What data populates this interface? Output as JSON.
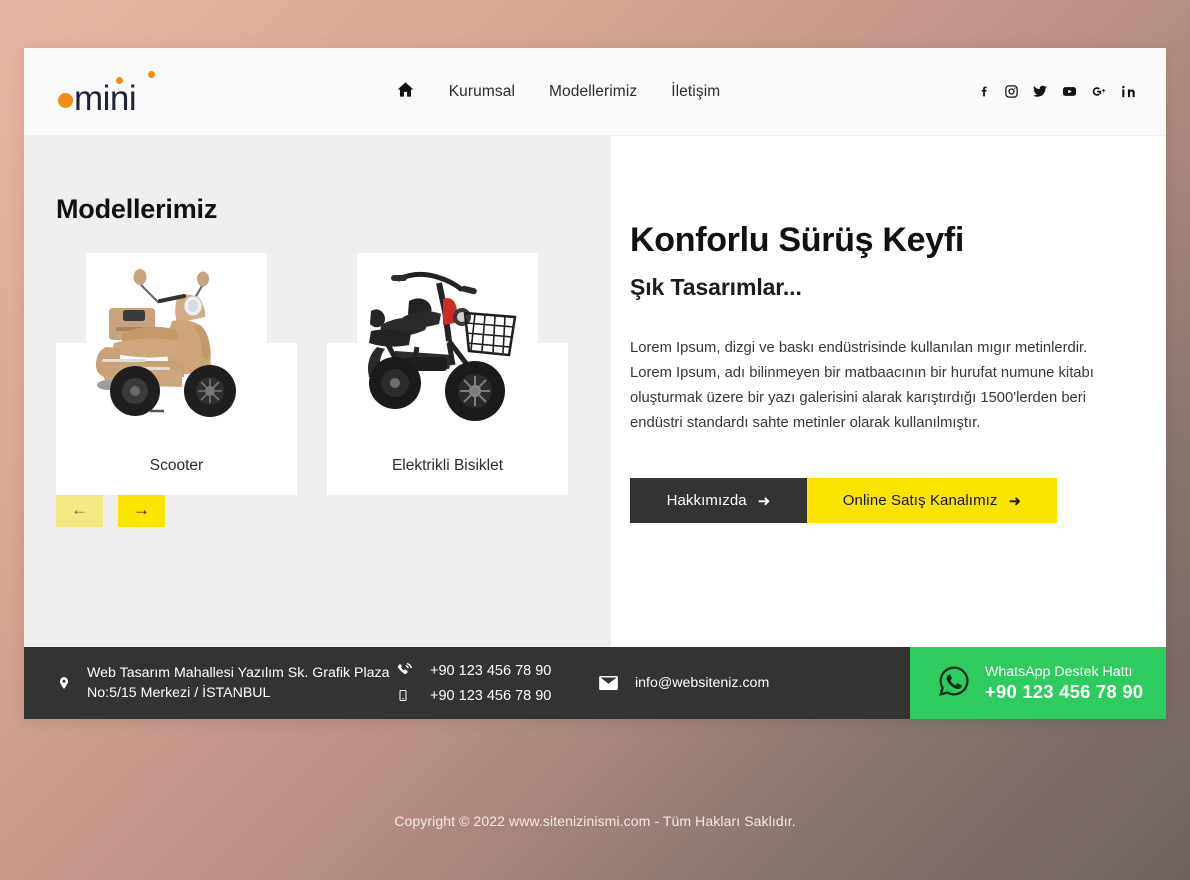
{
  "site": {
    "logo": {
      "text": "mini",
      "dot_color": "#f28d15",
      "word_color": "#1e2337"
    }
  },
  "nav": {
    "home_icon": "home-icon",
    "items": [
      {
        "label": "Kurumsal"
      },
      {
        "label": "Modellerimiz"
      },
      {
        "label": "İletişim"
      }
    ]
  },
  "socials": [
    {
      "name": "facebook-icon"
    },
    {
      "name": "instagram-icon"
    },
    {
      "name": "twitter-icon"
    },
    {
      "name": "youtube-icon"
    },
    {
      "name": "google-plus-icon"
    },
    {
      "name": "linkedin-icon"
    }
  ],
  "left": {
    "section_title": "Modellerimiz",
    "cards": [
      {
        "title": "Scooter",
        "image": "scooter-photo"
      },
      {
        "title": "Elektrikli Bisiklet",
        "image": "electric-bike-photo"
      }
    ],
    "carousel": {
      "prev_label": "←",
      "next_label": "→",
      "prev_color": "#f2ea7e",
      "next_color": "#fbe400"
    }
  },
  "right": {
    "title": "Konforlu Sürüş Keyfi",
    "subtitle": "Şık Tasarımlar...",
    "paragraph": "Lorem Ipsum, dizgi ve baskı endüstrisinde kullanılan mıgır metinlerdir. Lorem Ipsum, adı bilinmeyen bir matbaacının bir hurufat numune kitabı oluşturmak üzere bir yazı galerisini alarak karıştırdığı 1500'lerden beri endüstri standardı sahte metinler olarak kullanılmıştır.",
    "buttons": [
      {
        "label": "Hakkımızda",
        "arrow": "➜",
        "bg": "#333333",
        "fg": "#ffffff"
      },
      {
        "label": "Online Satış Kanalımız",
        "arrow": "➜",
        "bg": "#fbe400",
        "fg": "#141414"
      }
    ]
  },
  "contactbar": {
    "address": "Web Tasarım Mahallesi Yazılım Sk. Grafik Plaza No:5/15 Merkezi / İSTANBUL",
    "phone_1": "+90 123 456 78 90",
    "phone_2": "+90 123 456 78 90",
    "email": "info@websiteniz.com",
    "whatsapp_title": "WhatsApp Destek Hattı",
    "whatsapp_number": "+90 123 456 78 90",
    "whatsapp_color": "#2ecc5f"
  },
  "footer": {
    "copyright": "Copyright © 2022 www.sitenizinismi.com - Tüm Hakları Saklıdır."
  }
}
